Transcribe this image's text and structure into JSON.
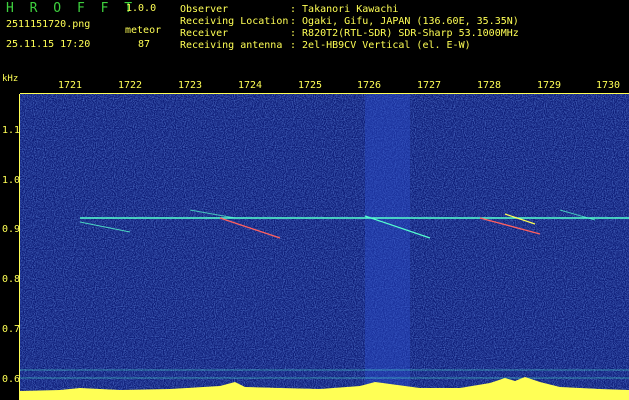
{
  "app": {
    "name": "H R O F F T",
    "version": "1.0.0"
  },
  "file": {
    "name": "2511151720.png",
    "datetime": "25.11.15 17:20"
  },
  "meteor": {
    "label": "meteor",
    "count": "87"
  },
  "info": [
    {
      "key": "Observer",
      "value": ": Takanori Kawachi"
    },
    {
      "key": "Receiving Location",
      "value": ": Ogaki, Gifu, JAPAN (136.60E, 35.35N)"
    },
    {
      "key": "Receiver",
      "value": ": R820T2(RTL-SDR) SDR-Sharp 53.1000MHz"
    },
    {
      "key": "Receiving antenna",
      "value": ": 2el-HB9CV Vertical (el. E-W)"
    }
  ],
  "axis": {
    "y_unit": "kHz",
    "y_ticks": [
      "1.1",
      "1.0",
      "0.9",
      "0.8",
      "0.7",
      "0.6"
    ],
    "x_ticks": [
      "1721",
      "1722",
      "1723",
      "1724",
      "1725",
      "1726",
      "1727",
      "1728",
      "1729",
      "1730"
    ]
  },
  "colors": {
    "text": "#ffff55",
    "title": "#3ed13e",
    "background": "#0c1b76",
    "trace": "#55ffd0"
  }
}
